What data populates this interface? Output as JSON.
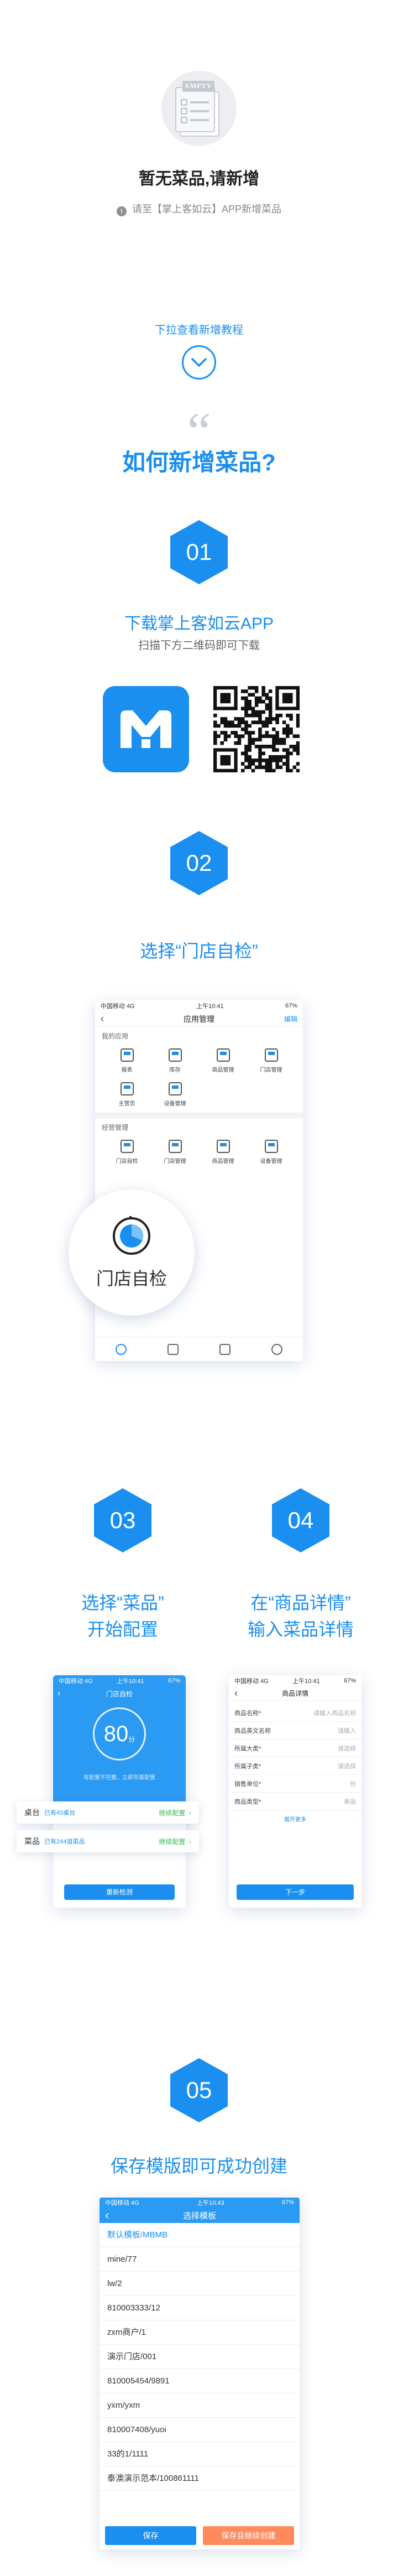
{
  "empty": {
    "badge": "EMPTY",
    "title": "暂无菜品,请新增",
    "hint": "请至【掌上客如云】APP新增菜品"
  },
  "pull": {
    "label": "下拉查看新增教程"
  },
  "tutorial": {
    "quote": "“",
    "heading": "如何新增菜品?"
  },
  "step1": {
    "num": "01",
    "title": "下载掌上客如云APP",
    "subtitle": "扫描下方二维码即可下载"
  },
  "step2": {
    "num": "02",
    "title": "选择“门店自检”",
    "screen": {
      "status_carrier": "中国移动 4G",
      "status_time": "上午10:41",
      "status_battery": "67%",
      "nav_title": "应用管理",
      "nav_right": "编辑",
      "my_apps_label": "我的应用",
      "my_apps": [
        "报表",
        "库存",
        "商品管理",
        "门店管理",
        "主营页",
        "设备管理"
      ],
      "manage_label": "经营管理",
      "manage_apps": [
        "门店自检",
        "门店管理",
        "商品管理",
        "设备管理"
      ],
      "bubble_label": "门店自检"
    }
  },
  "step3": {
    "num": "03",
    "title_line1": "选择“菜品”",
    "title_line2": "开始配置",
    "screen": {
      "status_carrier": "中国移动 4G",
      "status_time": "上午10:41",
      "status_battery": "67%",
      "nav_title": "门店自检",
      "score": "80",
      "score_unit": "分",
      "score_note": "有配置不完整，立即完善配置",
      "button": "重新检测"
    },
    "cards": [
      {
        "label": "桌台",
        "status": "已有43桌台",
        "action": "继续配置"
      },
      {
        "label": "菜品",
        "status": "已有244道菜品",
        "action": "继续配置"
      }
    ]
  },
  "step4": {
    "num": "04",
    "title_line1": "在“商品详情”",
    "title_line2": "输入菜品详情",
    "screen": {
      "status_carrier": "中国移动 4G",
      "status_time": "上午10:41",
      "status_battery": "67%",
      "nav_title": "商品详情",
      "fields": [
        {
          "label": "商品名称*",
          "value": "请输入商品名称"
        },
        {
          "label": "商品英文名称",
          "value": "请输入"
        },
        {
          "label": "所属大类*",
          "value": "请选择"
        },
        {
          "label": "所属子类*",
          "value": "请选择"
        },
        {
          "label": "销售单位*",
          "value": "份"
        },
        {
          "label": "商品类型*",
          "value": "单品"
        }
      ],
      "more": "展开更多",
      "button": "下一步"
    }
  },
  "step5": {
    "num": "05",
    "title": "保存模版即可成功创建",
    "screen": {
      "status_carrier": "中国移动 4G",
      "status_time": "上午10:43",
      "status_battery": "67%",
      "nav_title": "选择模板",
      "items": [
        "默认模板/MBMB",
        "mine/77",
        "lw/2",
        "810003333/12",
        "zxm商户/1",
        "演示门店/001",
        "810005454/9891",
        "yxm/yxm",
        "810007408/yuoi",
        "33的1/1111",
        "泰澳演示范本/100861111"
      ],
      "save_button": "保存",
      "save_continue_button": "保存且继续创建"
    }
  },
  "colors": {
    "accent": "#1a8ff0",
    "orange": "#ff8a5c",
    "gray_bg": "#eceef2"
  }
}
